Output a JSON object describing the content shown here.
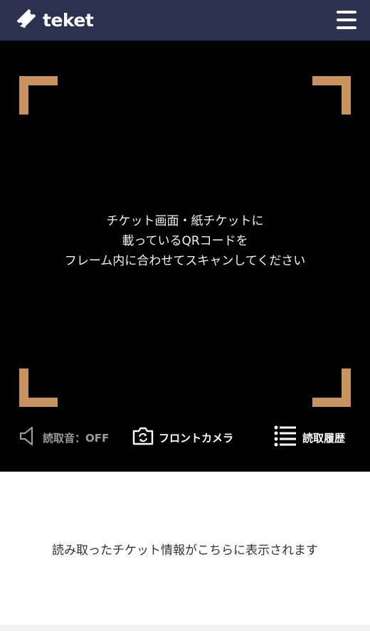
{
  "header": {
    "logo_text": "teket",
    "menu_icon": "hamburger-menu-icon",
    "background": "#2c3150"
  },
  "scanner": {
    "frame_color": "#c8925e",
    "instruction_lines": [
      "チケット画面・紙チケットに",
      "載っているQRコードを",
      "フレーム内に合わせてスキャンしてください"
    ]
  },
  "controls": {
    "sound_label": "読取音：OFF",
    "sound_icon": "speaker-icon",
    "camera_label": "フロントカメラ",
    "camera_icon": "camera-switch-icon",
    "history_label": "読取履歴",
    "history_icon": "list-icon"
  },
  "result": {
    "placeholder": "読み取ったチケット情報がこちらに表示されます"
  }
}
